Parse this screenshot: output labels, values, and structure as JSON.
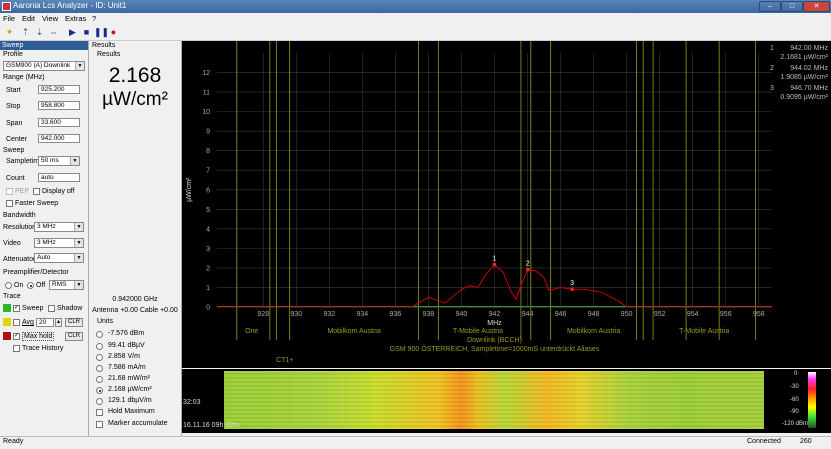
{
  "window": {
    "title": "Aaronia Lcs Analyzer - ID: Unit1"
  },
  "menu": [
    "File",
    "Edit",
    "View",
    "Extras",
    "?"
  ],
  "sweep": {
    "header": "Sweep",
    "profile_label": "Profile",
    "profile_value": "GSM900 (A) Downlink",
    "range_label": "Range (MHz)",
    "start_label": "Start",
    "start_value": "925.200",
    "stop_label": "Stop",
    "stop_value": "958.800",
    "span_label": "Span",
    "span_value": "33.600",
    "center_label": "Center",
    "center_value": "942.000",
    "sweep_group": "Sweep",
    "sampletime_label": "Sampletime",
    "sampletime_value": "50 ms",
    "count_label": "Count",
    "count_value": "auto",
    "pep_label": "PEP",
    "display_off_label": "Display off",
    "faster_sweep_label": "Faster Sweep",
    "bandwidth_label": "Bandwidth",
    "resolution_label": "Resolution",
    "resolution_value": "3 MHz",
    "video_label": "Video",
    "video_value": "3 MHz",
    "attenuator_label": "Attenuator",
    "attenuator_value": "Auto",
    "preamp_label": "Preamplifier/Detector",
    "on_label": "On",
    "off_label": "Off",
    "detector_value": "RMS",
    "trace_label": "Trace",
    "sweep_check_label": "Sweep",
    "shadow_label": "Shadow",
    "avg_label": "Avg",
    "avg_value": "20",
    "clr_label": "CLR",
    "maxhold_label": "Max hold",
    "trace_history_label": "Trace History"
  },
  "results": {
    "header": "Results",
    "group": "Results",
    "big_value": "2.168",
    "big_unit": "µW/cm²",
    "frequency": "0.942000 GHz",
    "antenna_line": "Antenna +0.00 Cable +0.00",
    "units_label": "Units",
    "units": [
      "-7.576 dBm",
      "99.41 dBµV",
      "2.858 V/m",
      "7.586 mA/m",
      "21.68 mW/m²",
      "2.168 µW/cm²",
      "129.1 dbµV/m"
    ],
    "selected_unit_index": 5,
    "hold_max_label": "Hold Maximum",
    "marker_acc_label": "Marker accumulate"
  },
  "markers_legend": [
    {
      "num": "1",
      "freq": "942.00 MHz",
      "val": "2.1681 µW/cm²"
    },
    {
      "num": "2",
      "freq": "944.02 MHz",
      "val": "1.9085 µW/cm²"
    },
    {
      "num": "3",
      "freq": "946.70 MHz",
      "val": "0.9095 µW/cm²"
    }
  ],
  "chart_data": {
    "type": "line",
    "xlabel": "MHz",
    "ylabel": "µW/cm²",
    "xlim": [
      925.2,
      958.8
    ],
    "ylim": [
      0,
      13
    ],
    "x_ticks": [
      928,
      930,
      932,
      934,
      936,
      938,
      940,
      942,
      944,
      946,
      948,
      950,
      952,
      954,
      956,
      958
    ],
    "y_ticks": [
      0,
      1,
      2,
      3,
      4,
      5,
      6,
      7,
      8,
      9,
      10,
      11,
      12
    ],
    "grid": true,
    "series": [
      {
        "x": [
          925.2,
          934.0,
          937.0,
          938.0,
          939.0,
          940.0,
          940.5,
          941.0,
          941.5,
          942.0,
          942.5,
          943.0,
          943.3,
          943.6,
          944.0,
          944.5,
          945.0,
          945.3,
          946.0,
          946.7,
          947.5,
          948.5,
          949.5,
          950.0,
          958.8
        ],
        "y": [
          0.0,
          0.0,
          0.0,
          0.5,
          0.2,
          0.9,
          1.1,
          1.0,
          1.7,
          2.17,
          1.8,
          0.8,
          0.4,
          1.1,
          1.91,
          1.85,
          1.5,
          0.85,
          1.0,
          0.91,
          0.9,
          0.75,
          0.3,
          0.0,
          0.0
        ]
      }
    ],
    "markers": [
      {
        "label": "1",
        "x": 942.0,
        "y": 2.17
      },
      {
        "label": "2",
        "x": 944.02,
        "y": 1.91
      },
      {
        "label": "3",
        "x": 946.7,
        "y": 0.91
      }
    ],
    "band_lines": [
      926.4,
      928.4,
      928.8,
      929.6,
      937.4,
      938.6,
      943.6,
      944.2,
      945.4,
      950.6,
      951.0,
      951.6,
      953.6,
      955.6,
      957.8
    ],
    "band_labels": [
      {
        "text": "One",
        "x": 927.3
      },
      {
        "text": "Mobilkom Austria",
        "x": 933.5
      },
      {
        "text": "T-Mobile Austria",
        "x": 941.0
      },
      {
        "text": "Mobilkom Austria",
        "x": 948.0
      },
      {
        "text": "T-Mobile Austria",
        "x": 954.7
      }
    ],
    "annotations": [
      "Downlink (BCCH)",
      "GSM 900 ÖSTERREICH, Sampletime=1000mS unterdrückt Aliases",
      "CT1+"
    ]
  },
  "waterfall": {
    "time1": "32:03",
    "time2": "16.11.16 09h 32m",
    "scale": [
      "0",
      "-30",
      "-60",
      "-90",
      "-120 dBm"
    ]
  },
  "status": {
    "left": "Ready",
    "connected": "Connected",
    "count": "260"
  },
  "colors": {
    "accent": "#2f5b96",
    "trace": "#cc0000",
    "band": "#9a9a1f",
    "grid": "#3a3a3a"
  }
}
